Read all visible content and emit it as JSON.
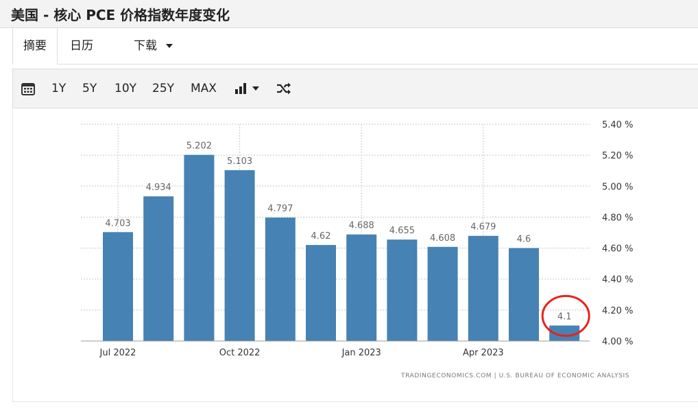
{
  "header": {
    "title": "美国 - 核心 PCE 价格指数年度变化"
  },
  "tabs": [
    {
      "label": "摘要",
      "active": true
    },
    {
      "label": "日历",
      "active": false
    },
    {
      "label": "下载",
      "active": false
    }
  ],
  "toolbar": {
    "calendar_icon": "calendar-icon",
    "ranges": [
      "1Y",
      "5Y",
      "10Y",
      "25Y",
      "MAX"
    ],
    "chart_type_icon": "bar-chart-icon",
    "shuffle_icon": "shuffle-icon"
  },
  "chart_data": {
    "type": "bar",
    "categories": [
      "2022-07",
      "2022-08",
      "2022-09",
      "2022-10",
      "2022-11",
      "2022-12",
      "2023-01",
      "2023-02",
      "2023-03",
      "2023-04",
      "2023-05",
      "2023-06"
    ],
    "values": [
      4.703,
      4.934,
      5.202,
      5.103,
      4.797,
      4.62,
      4.688,
      4.655,
      4.608,
      4.679,
      4.6,
      4.1
    ],
    "value_labels": [
      "4.703",
      "4.934",
      "5.202",
      "5.103",
      "4.797",
      "4.62",
      "4.688",
      "4.655",
      "4.608",
      "4.679",
      "4.6",
      "4.1"
    ],
    "x_tick_labels": [
      {
        "index": 0,
        "label": "Jul 2022"
      },
      {
        "index": 3,
        "label": "Oct 2022"
      },
      {
        "index": 6,
        "label": "Jan 2023"
      },
      {
        "index": 9,
        "label": "Apr 2023"
      }
    ],
    "y_ticks": [
      4.0,
      4.2,
      4.4,
      4.6,
      4.8,
      5.0,
      5.2,
      5.4
    ],
    "y_tick_labels": [
      "4.00 %",
      "4.20 %",
      "4.40 %",
      "4.60 %",
      "4.80 %",
      "5.00 %",
      "5.20 %",
      "5.40 %"
    ],
    "ylim": [
      4.0,
      5.4
    ],
    "grid": true,
    "bar_color": "#4682b4",
    "highlight": {
      "index": 11,
      "color": "#e8231c",
      "shape": "circle"
    },
    "source": "TRADINGECONOMICS.COM  |  U.S. BUREAU OF ECONOMIC ANALYSIS"
  }
}
